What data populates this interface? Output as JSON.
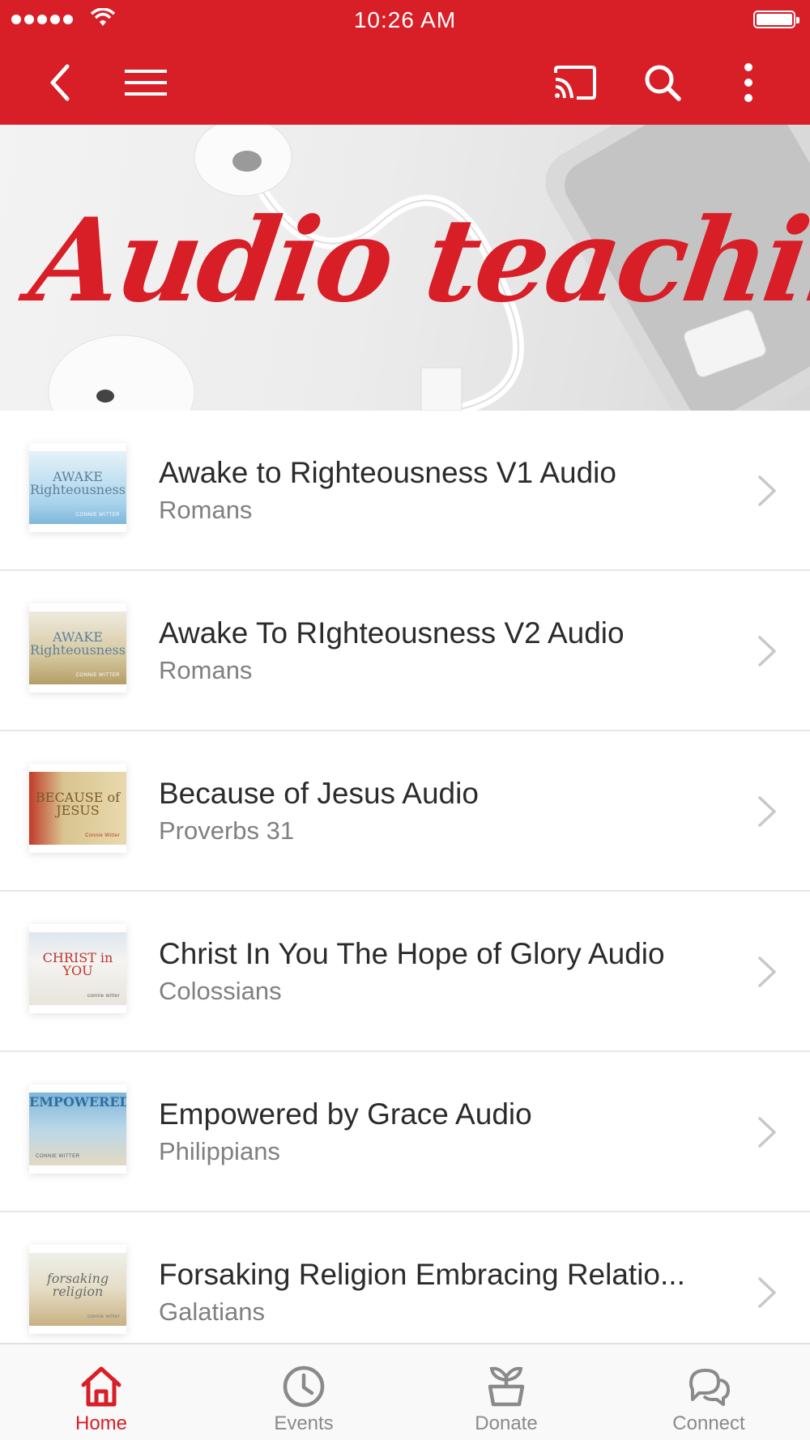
{
  "status_bar": {
    "time": "10:26 AM"
  },
  "toolbar": {
    "back_icon": "chevron-left-icon",
    "menu_icon": "hamburger-icon",
    "cast_icon": "cast-icon",
    "search_icon": "search-icon",
    "more_icon": "more-vertical-icon"
  },
  "hero": {
    "title": "Audio teaching"
  },
  "items": [
    {
      "title": "Awake to Righteousness V1 Audio",
      "subtitle": "Romans",
      "thumb_title": "AWAKE Righteousness",
      "thumb_author": "CONNIE WITTER",
      "thumb_color": "#a9d4ec"
    },
    {
      "title": "Awake To RIghteousness V2 Audio",
      "subtitle": "Romans",
      "thumb_title": "AWAKE Righteousness",
      "thumb_author": "CONNIE WITTER",
      "thumb_color": "#c9b88a"
    },
    {
      "title": "Because of Jesus Audio",
      "subtitle": "Proverbs 31",
      "thumb_title": "BECAUSE of JESUS",
      "thumb_author": "Connie Witter",
      "thumb_color": "#d9c48f"
    },
    {
      "title": "Christ In You The Hope of Glory Audio",
      "subtitle": "Colossians",
      "thumb_title": "CHRIST in YOU",
      "thumb_author": "connie witter",
      "thumb_color": "#e9ecef"
    },
    {
      "title": "Empowered by Grace Audio",
      "subtitle": "Philippians",
      "thumb_title": "EMPOWERED!",
      "thumb_author": "CONNIE WITTER",
      "thumb_color": "#9cc5de"
    },
    {
      "title": "Forsaking Religion Embracing Relatio...",
      "subtitle": "Galatians",
      "thumb_title": "forsaking religion",
      "thumb_author": "connie witter",
      "thumb_color": "#c8b183"
    }
  ],
  "tabs": [
    {
      "label": "Home",
      "icon": "home-icon",
      "active": true
    },
    {
      "label": "Events",
      "icon": "clock-icon",
      "active": false
    },
    {
      "label": "Donate",
      "icon": "plant-icon",
      "active": false
    },
    {
      "label": "Connect",
      "icon": "chat-bubbles-icon",
      "active": false
    }
  ],
  "colors": {
    "brand": "#d81e27",
    "text": "#2b2b2b",
    "subtext": "#808080"
  }
}
